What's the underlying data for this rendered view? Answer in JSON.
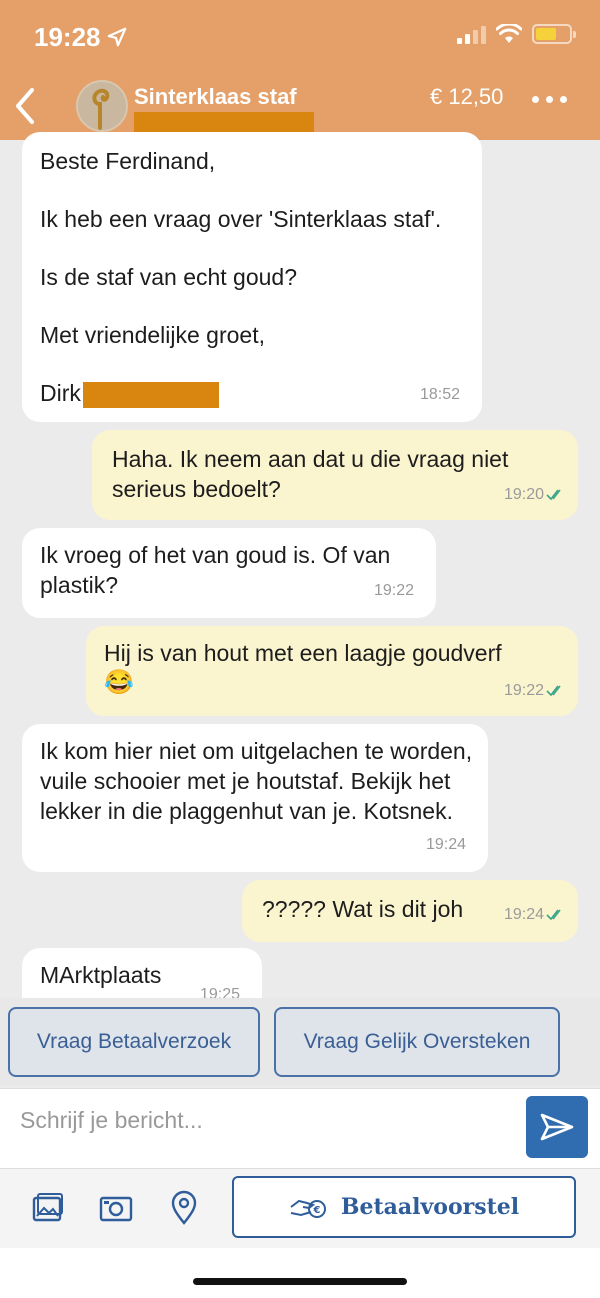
{
  "status": {
    "time": "19:28"
  },
  "header": {
    "title": "Sinterklaas staf",
    "price": "€ 12,50"
  },
  "messages": [
    {
      "dir": "in",
      "lines": [
        "Beste Ferdinand,",
        "Ik heb een vraag over 'Sinterklaas staf'.",
        "Is de staf van echt goud?",
        "Met vriendelijke groet,"
      ],
      "signoff": "Dirk",
      "time": "18:52"
    },
    {
      "dir": "out",
      "text": "Haha. Ik neem aan dat u die vraag niet serieus bedoelt?",
      "time": "19:20"
    },
    {
      "dir": "in",
      "text": "Ik vroeg of het van goud is. Of van plastik?",
      "time": "19:22"
    },
    {
      "dir": "out",
      "text": "Hij is van hout met een laagje goudverf",
      "emoji": "😂",
      "time": "19:22"
    },
    {
      "dir": "in",
      "text": "Ik kom hier niet om uitgelachen te worden, vuile schooier met je houtstaf. Bekijk het lekker in die plaggenhut van je. Kotsnek.",
      "time": "19:24"
    },
    {
      "dir": "out",
      "text": "????? Wat is dit joh",
      "time": "19:24"
    },
    {
      "dir": "in",
      "text": "MArktplaats",
      "time": "19:25"
    }
  ],
  "actions": {
    "request_payment": "Vraag Betaalverzoek",
    "equal_split": "Vraag Gelijk Oversteken"
  },
  "compose": {
    "placeholder": "Schrijf je bericht..."
  },
  "toolbar": {
    "payment_proposal": "Betaalvoorstel"
  },
  "colors": {
    "header": "#e4a068",
    "outgoing_bubble": "#faf4cf",
    "incoming_bubble": "#ffffff",
    "accent_blue": "#2f6cb0",
    "redaction": "#d8860f"
  }
}
